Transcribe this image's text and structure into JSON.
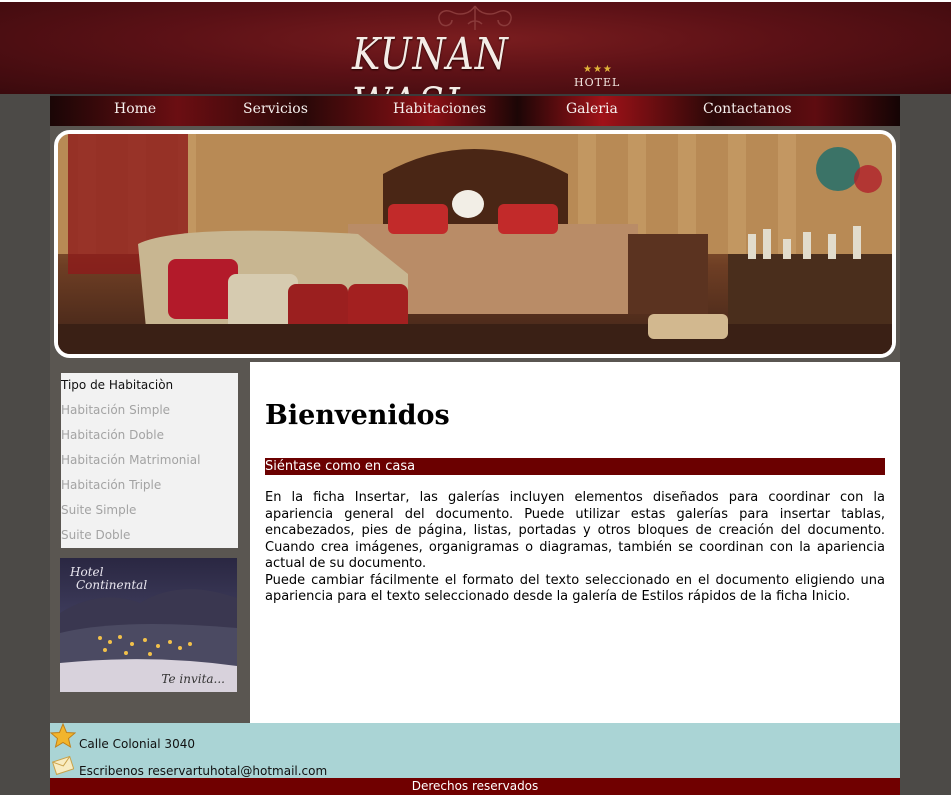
{
  "header": {
    "logo_title": "KUNAN WASI",
    "logo_stars": "★★★",
    "logo_sub": "HOTEL"
  },
  "nav": {
    "items": [
      {
        "label": "Home"
      },
      {
        "label": "Servicios"
      },
      {
        "label": "Habitaciones"
      },
      {
        "label": "Galeria"
      },
      {
        "label": "Contactanos"
      }
    ]
  },
  "sidebar": {
    "heading": "Tipo de Habitaciòn",
    "items": [
      {
        "label": "Habitación Simple"
      },
      {
        "label": "Habitación Doble"
      },
      {
        "label": "Habitación Matrimonial"
      },
      {
        "label": "Habitación Triple"
      },
      {
        "label": "Suite Simple"
      },
      {
        "label": "Suite Doble"
      }
    ],
    "promo": {
      "brand_line1": "Hotel",
      "brand_line2": "Continental",
      "tagline": "Te invita..."
    }
  },
  "main": {
    "title": "Bienvenidos",
    "subtitle": "Siéntase como en casa",
    "paragraphs": [
      "En la ficha Insertar, las galerías incluyen elementos diseñados para coordinar con la apariencia general del documento. Puede utilizar estas galerías para insertar tablas, encabezados, pies de página, listas, portadas y otros bloques de creación del documento. Cuando crea imágenes, organigramas o diagramas, también se coordinan con la apariencia actual de su documento.",
      "Puede cambiar fácilmente el formato del texto seleccionado en el documento eligiendo una apariencia para el texto seleccionado desde la galería de Estilos rápidos de la ficha Inicio."
    ]
  },
  "footer": {
    "address": "Calle Colonial 3040",
    "email": "Escribenos reservartuhotal@hotmail.com",
    "address_icon": "star-icon",
    "email_icon": "envelope-icon",
    "copyright": "Derechos reservados"
  },
  "colors": {
    "header_bg": "#5c1116",
    "subtitle_bg": "#6b0000",
    "footer_bg": "#aad4d5",
    "copyright_bg": "#700000",
    "page_bg": "#4c4a47"
  }
}
